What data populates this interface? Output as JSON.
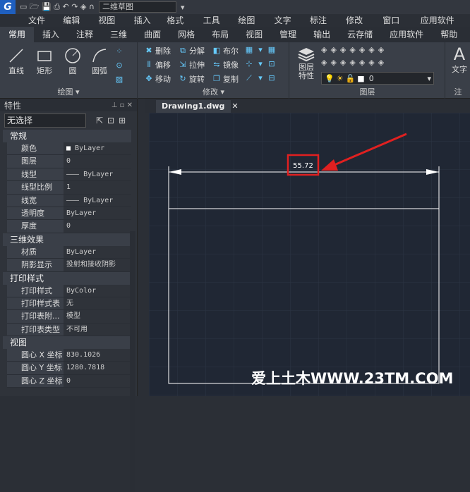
{
  "titlebar": {
    "logo": "G",
    "workspace": "二维草图"
  },
  "menu": [
    "文件(F)",
    "编辑(E)",
    "视图(V)",
    "插入(I)",
    "格式(O)",
    "工具(T)",
    "绘图(D)",
    "文字(X)",
    "标注(N)",
    "修改(M)",
    "窗口(W)",
    "应用软件(A)"
  ],
  "tabs": [
    "常用",
    "插入",
    "注释",
    "三维",
    "曲面",
    "网格",
    "布局",
    "视图",
    "管理",
    "输出",
    "云存储",
    "应用软件",
    "帮助"
  ],
  "ribbon": {
    "draw": {
      "label": "绘图",
      "tools": [
        "直线",
        "矩形",
        "圆",
        "圆弧"
      ]
    },
    "modify": {
      "label": "修改",
      "tools": [
        "删除",
        "分解",
        "布尔",
        "偏移",
        "拉伸",
        "镜像",
        "移动",
        "旋转",
        "复制"
      ]
    },
    "layer": {
      "label": "图层",
      "props_label": "图层特性",
      "current": "0"
    },
    "text": {
      "label": "文字"
    }
  },
  "props": {
    "title": "特性",
    "selection": "无选择",
    "sections": [
      {
        "name": "常规",
        "rows": [
          [
            "颜色",
            "ByLayer"
          ],
          [
            "图层",
            "0"
          ],
          [
            "线型",
            "ByLayer"
          ],
          [
            "线型比例",
            "1"
          ],
          [
            "线宽",
            "ByLayer"
          ],
          [
            "透明度",
            "ByLayer"
          ],
          [
            "厚度",
            "0"
          ]
        ]
      },
      {
        "name": "三维效果",
        "rows": [
          [
            "材质",
            "ByLayer"
          ],
          [
            "阴影显示",
            "投射和接收阴影"
          ]
        ]
      },
      {
        "name": "打印样式",
        "rows": [
          [
            "打印样式",
            "ByColor"
          ],
          [
            "打印样式表",
            "无"
          ],
          [
            "打印表附...",
            "模型"
          ],
          [
            "打印表类型",
            "不可用"
          ]
        ]
      },
      {
        "name": "视图",
        "rows": [
          [
            "圆心 X 坐标",
            "830.1026"
          ],
          [
            "圆心 Y 坐标",
            "1280.7818"
          ],
          [
            "圆心 Z 坐标",
            "0"
          ]
        ]
      }
    ]
  },
  "doc": {
    "tab": "Drawing1.dwg"
  },
  "drawing": {
    "dimension_text": "55.72"
  },
  "watermark": "爱上土木WWW.23TM.COM",
  "colors": {
    "accent": "#e02020",
    "canvas": "#202734"
  }
}
